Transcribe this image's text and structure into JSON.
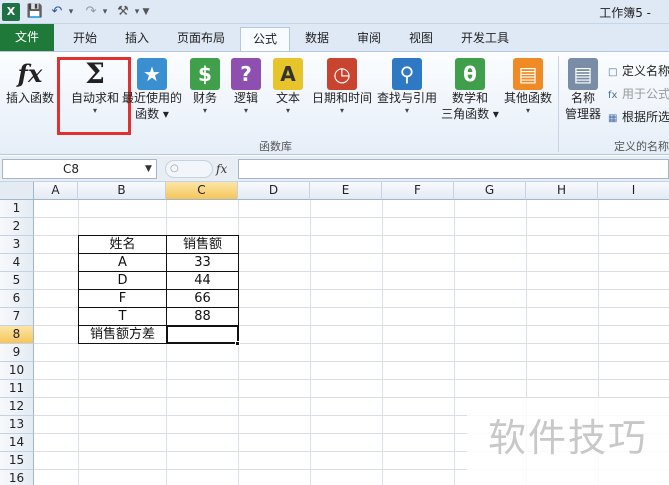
{
  "title_bar": {
    "app_icon": "X",
    "title": "工作簿5 -"
  },
  "tabs": [
    {
      "label": "文件"
    },
    {
      "label": "开始"
    },
    {
      "label": "插入"
    },
    {
      "label": "页面布局"
    },
    {
      "label": "公式"
    },
    {
      "label": "数据"
    },
    {
      "label": "审阅"
    },
    {
      "label": "视图"
    },
    {
      "label": "开发工具"
    }
  ],
  "ribbon": {
    "insert_function": "插入函数",
    "autosum_l1": "自动求和",
    "recent_l1": "最近使用的",
    "recent_l2": "函数",
    "financial": "财务",
    "logical": "逻辑",
    "text": "文本",
    "datetime": "日期和时间",
    "lookup": "查找与引用",
    "math_l1": "数学和",
    "math_l2": "三角函数",
    "more": "其他函数",
    "name_l1": "名称",
    "name_l2": "管理器",
    "define_name": "定义名称",
    "use_in_formula": "用于公式",
    "create_from_sel": "根据所选",
    "group_library": "函数库",
    "group_names": "定义的名称"
  },
  "formula_bar": {
    "name_box": "C8",
    "fx": "fx",
    "value": ""
  },
  "columns": [
    "A",
    "B",
    "C",
    "D",
    "E",
    "F",
    "G",
    "H",
    "I"
  ],
  "rows": [
    "1",
    "2",
    "3",
    "4",
    "5",
    "6",
    "7",
    "8",
    "9",
    "10",
    "11",
    "12",
    "13",
    "14",
    "15",
    "16"
  ],
  "table": {
    "header_name": "姓名",
    "header_sales": "销售额",
    "rows": [
      {
        "name": "A",
        "sales": "33"
      },
      {
        "name": "D",
        "sales": "44"
      },
      {
        "name": "F",
        "sales": "66"
      },
      {
        "name": "T",
        "sales": "88"
      }
    ],
    "variance_label": "销售额方差",
    "variance_value": ""
  },
  "watermark": "软件技巧",
  "colors": {
    "file_tab": "#1f7a3a",
    "highlight": "#e03030",
    "selected_header": "#f5c55a"
  }
}
